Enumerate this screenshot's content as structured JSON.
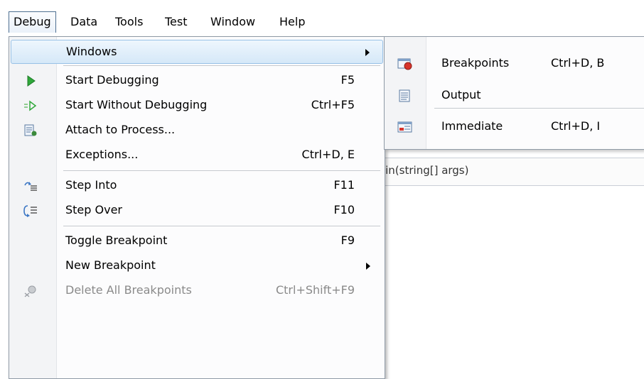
{
  "menubar": {
    "items": [
      "Debug",
      "Data",
      "Tools",
      "Test",
      "Window",
      "Help"
    ]
  },
  "editor": {
    "nav_text": "Main(string[] args)"
  },
  "debug_menu": {
    "items": [
      {
        "label": "Windows",
        "shortcut": "",
        "icon": "none",
        "submenu": true
      },
      {
        "label": "Start Debugging",
        "shortcut": "F5",
        "icon": "play-icon"
      },
      {
        "label": "Start Without Debugging",
        "shortcut": "Ctrl+F5",
        "icon": "play-outline-icon"
      },
      {
        "label": "Attach to Process...",
        "shortcut": "",
        "icon": "attach-process-icon"
      },
      {
        "label": "Exceptions...",
        "shortcut": "Ctrl+D, E",
        "icon": "none"
      },
      {
        "label": "Step Into",
        "shortcut": "F11",
        "icon": "step-into-icon"
      },
      {
        "label": "Step Over",
        "shortcut": "F10",
        "icon": "step-over-icon"
      },
      {
        "label": "Toggle Breakpoint",
        "shortcut": "F9",
        "icon": "none"
      },
      {
        "label": "New Breakpoint",
        "shortcut": "",
        "icon": "none",
        "submenu": true
      },
      {
        "label": "Delete All Breakpoints",
        "shortcut": "Ctrl+Shift+F9",
        "icon": "delete-breakpoints-icon",
        "disabled": true
      }
    ]
  },
  "windows_submenu": {
    "items": [
      {
        "label": "Breakpoints",
        "shortcut": "Ctrl+D, B",
        "icon": "breakpoints-window-icon"
      },
      {
        "label": "Output",
        "shortcut": "",
        "icon": "output-window-icon"
      },
      {
        "label": "Immediate",
        "shortcut": "Ctrl+D, I",
        "icon": "immediate-window-icon"
      }
    ]
  },
  "colors": {
    "highlight": "#d5e8f8",
    "highlight_border": "#98c1e6",
    "disabled_text": "#8a8a8a",
    "play_green": "#2fa83a"
  }
}
